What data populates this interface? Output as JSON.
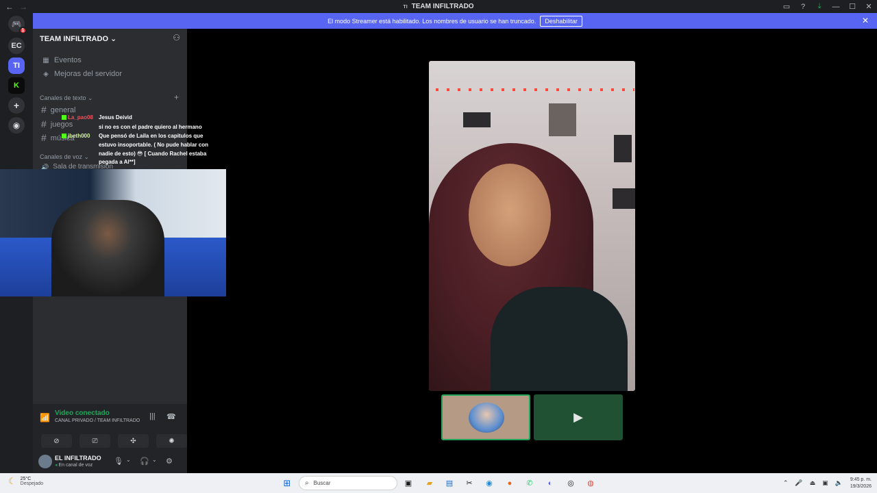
{
  "window": {
    "title": "TEAM INFILTRADO",
    "nav_back": "←",
    "nav_forward": "→",
    "app_icon": "TI"
  },
  "banner": {
    "text": "El modo Streamer está habilitado. Los nombres de usuario se han truncado.",
    "button": "Deshabilitar"
  },
  "rail": {
    "items": [
      {
        "label": "",
        "icon": "discord-icon",
        "badge": "1"
      },
      {
        "label": "EC"
      },
      {
        "label": "TI",
        "active": true
      },
      {
        "label": "",
        "icon": "kick-icon"
      },
      {
        "label": "+",
        "icon": "add-server-icon"
      },
      {
        "label": "",
        "icon": "explore-icon"
      }
    ]
  },
  "sidebar": {
    "server_name": "TEAM INFILTRADO ⌄",
    "events": "Eventos",
    "boosts": "Mejoras del servidor",
    "text_category": "Canales de texto ⌄",
    "text_channels": [
      "general",
      "juegos",
      "música"
    ],
    "voice_category": "Canales de voz ⌄",
    "voice_channel": "Sala de transmisión"
  },
  "chat": {
    "messages": [
      {
        "user": "La_pao08",
        "text": "Jesus Deivid"
      },
      {
        "user": "",
        "text": "si no es con el padre quiero al hermano"
      },
      {
        "user": "jbeth000",
        "text": "Que pensó de Laila en los capitulos que"
      },
      {
        "user": "",
        "text": "estuvo insoportable. ( No pude hablar con"
      },
      {
        "user": "",
        "text": "nadie de esto) 😳 [ Cuando Rachel estaba"
      },
      {
        "user": "",
        "text": "pegada a Al**]"
      }
    ]
  },
  "voice": {
    "status": "Video conectado",
    "location": "CANAL PRIVADO / TEAM INFILTRADO"
  },
  "user": {
    "name": "EL INFILTRADO",
    "status": "En canal de voz"
  },
  "taskbar": {
    "temp": "25°C",
    "condition": "Despejado",
    "search_placeholder": "Buscar",
    "time": "9:45 p. m.",
    "date": "19/3/2026"
  }
}
